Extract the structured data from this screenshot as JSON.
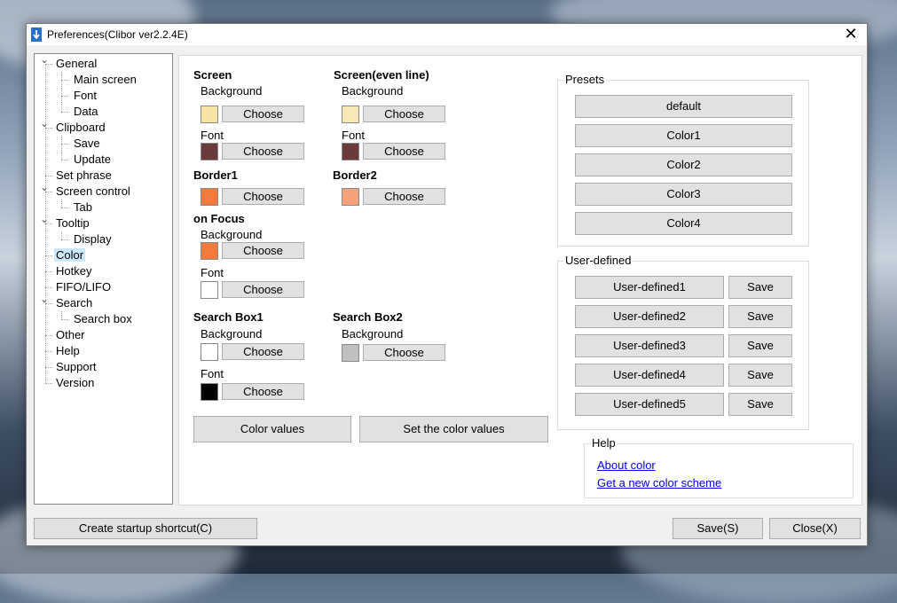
{
  "window": {
    "title": "Preferences(Clibor ver2.2.4E)",
    "close_glyph": "✕"
  },
  "tree": {
    "items": [
      {
        "label": "General",
        "level": 0,
        "expanded": true
      },
      {
        "label": "Main screen",
        "level": 1
      },
      {
        "label": "Font",
        "level": 1
      },
      {
        "label": "Data",
        "level": 1
      },
      {
        "label": "Clipboard",
        "level": 0,
        "expanded": true
      },
      {
        "label": "Save",
        "level": 1
      },
      {
        "label": "Update",
        "level": 1
      },
      {
        "label": "Set phrase",
        "level": 0
      },
      {
        "label": "Screen control",
        "level": 0,
        "expanded": true
      },
      {
        "label": "Tab",
        "level": 1
      },
      {
        "label": "Tooltip",
        "level": 0,
        "expanded": true
      },
      {
        "label": "Display",
        "level": 1
      },
      {
        "label": "Color",
        "level": 0,
        "selected": true
      },
      {
        "label": "Hotkey",
        "level": 0
      },
      {
        "label": "FIFO/LIFO",
        "level": 0
      },
      {
        "label": "Search",
        "level": 0,
        "expanded": true
      },
      {
        "label": "Search box",
        "level": 1
      },
      {
        "label": "Other",
        "level": 0
      },
      {
        "label": "Help",
        "level": 0
      },
      {
        "label": "Support",
        "level": 0
      },
      {
        "label": "Version",
        "level": 0
      }
    ]
  },
  "color": {
    "choose_label": "Choose",
    "background_label": "Background",
    "font_label": "Font",
    "screen": {
      "title": "Screen",
      "bg": "#f7e3a3",
      "font": "#6b3a3a"
    },
    "screen_even": {
      "title": "Screen(even line)",
      "bg": "#f7e9b8",
      "font": "#6b3a3a"
    },
    "border1": {
      "title": "Border1",
      "color": "#f27a3c"
    },
    "border2": {
      "title": "Border2",
      "color": "#f5a27c"
    },
    "on_focus": {
      "title": "on Focus",
      "bg": "#f27a3c",
      "font": "#ffffff"
    },
    "search_box1": {
      "title": "Search Box1",
      "bg": "#ffffff",
      "font": "#000000"
    },
    "search_box2": {
      "title": "Search Box2",
      "bg": "#c0c0c0"
    },
    "color_values_button": "Color values",
    "set_color_values_button": "Set the color values"
  },
  "presets": {
    "title": "Presets",
    "buttons": [
      "default",
      "Color1",
      "Color2",
      "Color3",
      "Color4"
    ]
  },
  "user_defined": {
    "title": "User-defined",
    "items": [
      "User-defined1",
      "User-defined2",
      "User-defined3",
      "User-defined4",
      "User-defined5"
    ],
    "save_label": "Save"
  },
  "help": {
    "title": "Help",
    "links": [
      "About color",
      "Get a new color scheme"
    ]
  },
  "footer": {
    "startup_shortcut": "Create startup shortcut(C)",
    "save": "Save(S)",
    "close": "Close(X)"
  }
}
